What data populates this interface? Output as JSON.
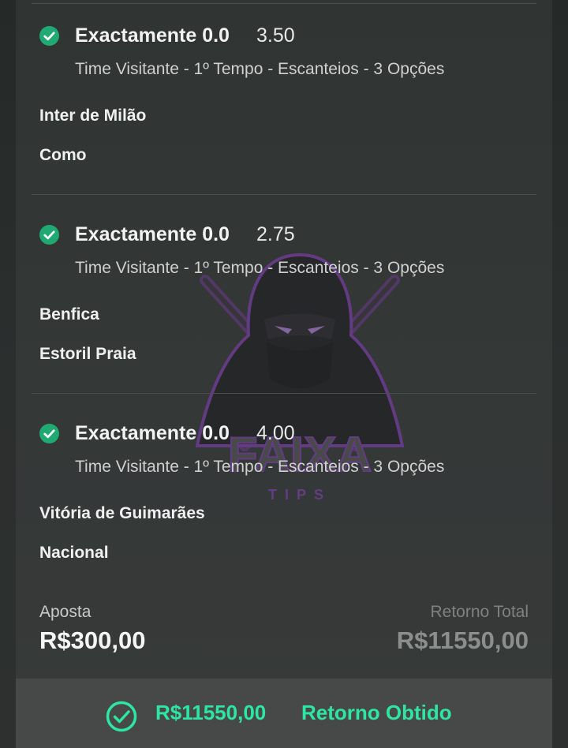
{
  "selections": [
    {
      "title": "Exactamente 0.0",
      "odds": "3.50",
      "market": "Time Visitante - 1º Tempo - Escanteios - 3 Opções",
      "home_team": "Inter de Milão",
      "away_team": "Como",
      "status_icon": "check-circle-icon"
    },
    {
      "title": "Exactamente 0.0",
      "odds": "2.75",
      "market": "Time Visitante - 1º Tempo - Escanteios - 3 Opções",
      "home_team": "Benfica",
      "away_team": "Estoril Praia",
      "status_icon": "check-circle-icon"
    },
    {
      "title": "Exactamente 0.0",
      "odds": "4.00",
      "market": "Time Visitante - 1º Tempo - Escanteios - 3 Opções",
      "home_team": "Vitória de Guimarães",
      "away_team": "Nacional",
      "status_icon": "check-circle-icon"
    }
  ],
  "summary": {
    "stake_label": "Aposta",
    "stake_value": "R$300,00",
    "return_label": "Retorno Total",
    "return_value": "R$11550,00"
  },
  "footer": {
    "amount": "R$11550,00",
    "status_text": "Retorno Obtido",
    "icon": "check-circle-outline-icon"
  },
  "watermark": {
    "brand": "FAIXA",
    "sub": "TIPS"
  },
  "colors": {
    "success_green": "#2ee6a4",
    "check_green": "#1faa73",
    "watermark_purple": "#8a3fc0"
  }
}
